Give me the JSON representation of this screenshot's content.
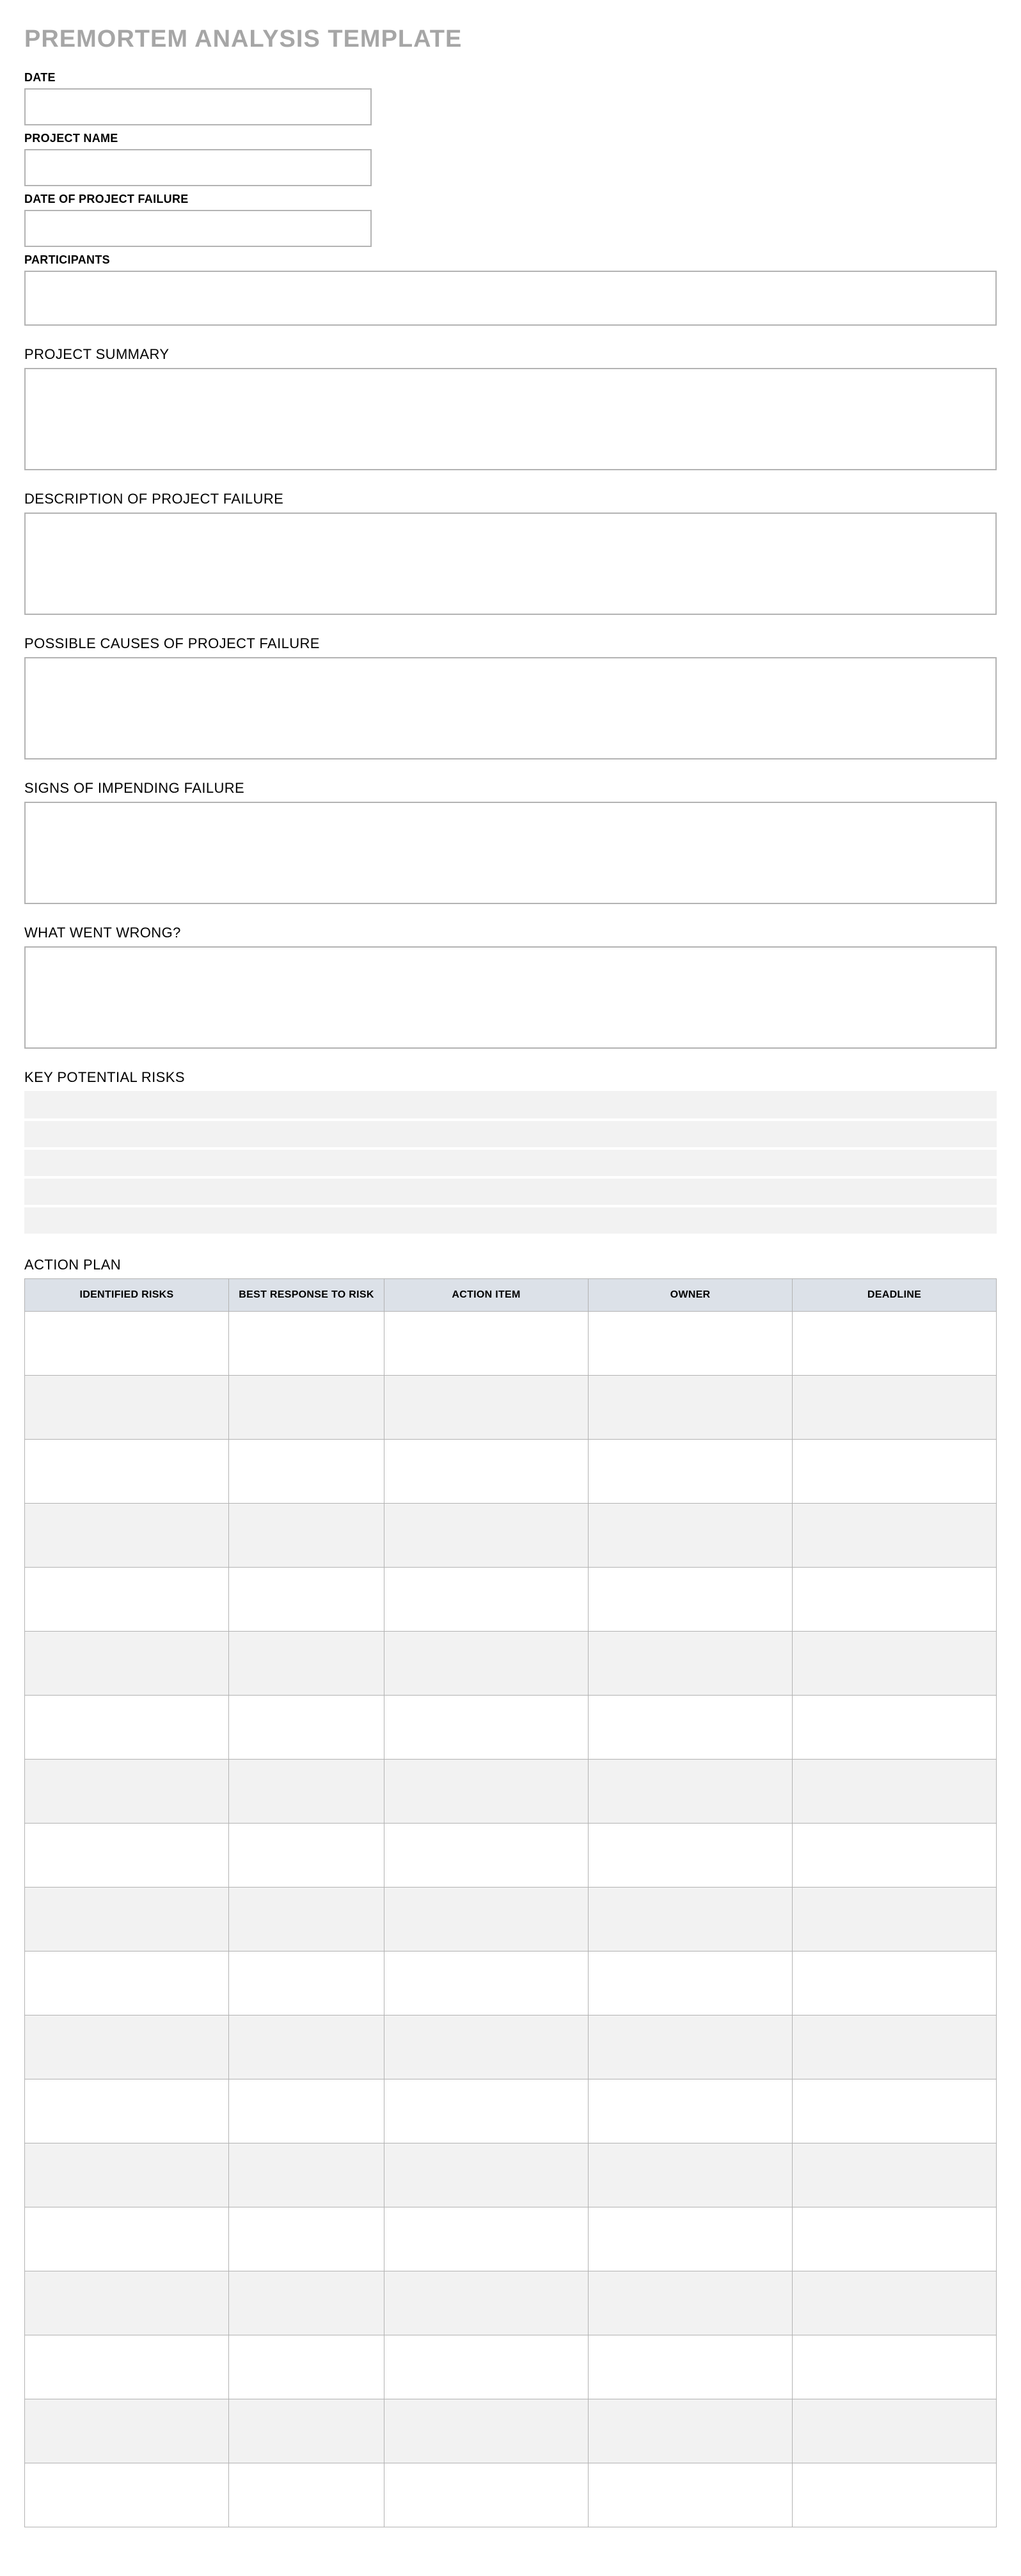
{
  "title": "PREMORTEM ANALYSIS TEMPLATE",
  "fields": {
    "date": {
      "label": "DATE",
      "value": ""
    },
    "project_name": {
      "label": "PROJECT NAME",
      "value": ""
    },
    "date_failure": {
      "label": "DATE OF PROJECT FAILURE",
      "value": ""
    },
    "participants": {
      "label": "PARTICIPANTS",
      "value": ""
    }
  },
  "sections": {
    "project_summary": {
      "label": "PROJECT SUMMARY",
      "value": ""
    },
    "description_failure": {
      "label": "DESCRIPTION OF PROJECT FAILURE",
      "value": ""
    },
    "possible_causes": {
      "label": "POSSIBLE CAUSES OF PROJECT FAILURE",
      "value": ""
    },
    "signs_impending": {
      "label": "SIGNS OF IMPENDING FAILURE",
      "value": ""
    },
    "what_went_wrong": {
      "label": "WHAT WENT WRONG?",
      "value": ""
    }
  },
  "key_risks": {
    "label": "KEY POTENTIAL RISKS",
    "rows": [
      "",
      "",
      "",
      "",
      ""
    ]
  },
  "action_plan": {
    "label": "ACTION PLAN",
    "headers": [
      "IDENTIFIED RISKS",
      "BEST RESPONSE TO RISK",
      "ACTION ITEM",
      "OWNER",
      "DEADLINE"
    ],
    "rows": [
      [
        "",
        "",
        "",
        "",
        ""
      ],
      [
        "",
        "",
        "",
        "",
        ""
      ],
      [
        "",
        "",
        "",
        "",
        ""
      ],
      [
        "",
        "",
        "",
        "",
        ""
      ],
      [
        "",
        "",
        "",
        "",
        ""
      ],
      [
        "",
        "",
        "",
        "",
        ""
      ],
      [
        "",
        "",
        "",
        "",
        ""
      ],
      [
        "",
        "",
        "",
        "",
        ""
      ],
      [
        "",
        "",
        "",
        "",
        ""
      ],
      [
        "",
        "",
        "",
        "",
        ""
      ],
      [
        "",
        "",
        "",
        "",
        ""
      ],
      [
        "",
        "",
        "",
        "",
        ""
      ],
      [
        "",
        "",
        "",
        "",
        ""
      ],
      [
        "",
        "",
        "",
        "",
        ""
      ],
      [
        "",
        "",
        "",
        "",
        ""
      ],
      [
        "",
        "",
        "",
        "",
        ""
      ],
      [
        "",
        "",
        "",
        "",
        ""
      ],
      [
        "",
        "",
        "",
        "",
        ""
      ],
      [
        "",
        "",
        "",
        "",
        ""
      ]
    ]
  }
}
